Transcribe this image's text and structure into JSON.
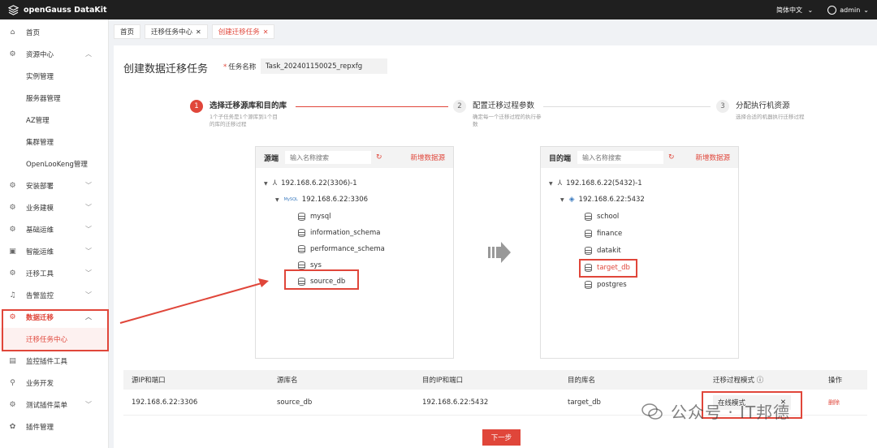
{
  "app": {
    "title": "openGauss DataKit",
    "language": "简体中文",
    "user": "admin"
  },
  "sidebar": {
    "items": [
      {
        "label": "首页",
        "icon": "home-icon"
      },
      {
        "label": "资源中心",
        "icon": "gear-icon",
        "expanded": true,
        "children": [
          "实例管理",
          "服务器管理",
          "AZ管理",
          "集群管理",
          "OpenLooKeng管理"
        ]
      },
      {
        "label": "安装部署",
        "icon": "gear-icon"
      },
      {
        "label": "业务建模",
        "icon": "gear-icon"
      },
      {
        "label": "基础运维",
        "icon": "gear-icon"
      },
      {
        "label": "智能运维",
        "icon": "monitor-icon"
      },
      {
        "label": "迁移工具",
        "icon": "gear-icon"
      },
      {
        "label": "告警监控",
        "icon": "bell-icon"
      },
      {
        "label": "数据迁移",
        "icon": "gear-icon",
        "active": true,
        "children": [
          "迁移任务中心"
        ]
      },
      {
        "label": "监控插件工具",
        "icon": "chart-icon"
      },
      {
        "label": "业务开发",
        "icon": "search-icon"
      },
      {
        "label": "测试插件菜单",
        "icon": "gear-icon"
      },
      {
        "label": "插件管理",
        "icon": "plugin-icon"
      }
    ]
  },
  "tabs": [
    {
      "label": "首页",
      "closable": false
    },
    {
      "label": "迁移任务中心",
      "closable": true
    },
    {
      "label": "创建迁移任务",
      "closable": true,
      "active": true
    }
  ],
  "page": {
    "title": "创建数据迁移任务",
    "task_name_label": "任务名称",
    "task_name_value": "Task_202401150025_repxfg"
  },
  "steps": [
    {
      "num": "1",
      "title": "选择迁移源库和目的库",
      "desc": "1个子任务是1个源库到1个目的库的迁移过程"
    },
    {
      "num": "2",
      "title": "配置迁移过程参数",
      "desc": "确定每一个迁移过程的执行参数"
    },
    {
      "num": "3",
      "title": "分配执行机资源",
      "desc": "选择合适的机器执行迁移过程"
    }
  ],
  "source": {
    "title": "源端",
    "search_placeholder": "输入名称搜索",
    "add_label": "新增数据源",
    "cluster": "192.168.6.22(3306)-1",
    "instance": "192.168.6.22:3306",
    "instance_badge": "MySQL",
    "databases": [
      "mysql",
      "information_schema",
      "performance_schema",
      "sys",
      "source_db"
    ],
    "selected": "source_db"
  },
  "target": {
    "title": "目的端",
    "search_placeholder": "输入名称搜索",
    "add_label": "新增数据源",
    "cluster": "192.168.6.22(5432)-1",
    "instance": "192.168.6.22:5432",
    "databases": [
      "school",
      "finance",
      "datakit",
      "target_db",
      "postgres"
    ],
    "selected": "target_db"
  },
  "table": {
    "headers": [
      "源IP和端口",
      "源库名",
      "目的IP和端口",
      "目的库名",
      "迁移过程模式",
      "操作"
    ],
    "rows": [
      {
        "src_ip": "192.168.6.22:3306",
        "src_db": "source_db",
        "dst_ip": "192.168.6.22:5432",
        "dst_db": "target_db",
        "mode": "在线模式",
        "action": "删除"
      }
    ]
  },
  "next_button": "下一步",
  "watermark": "公众号 · IT邦德",
  "colors": {
    "accent": "#e0463a",
    "topbar": "#1f1f1f"
  }
}
